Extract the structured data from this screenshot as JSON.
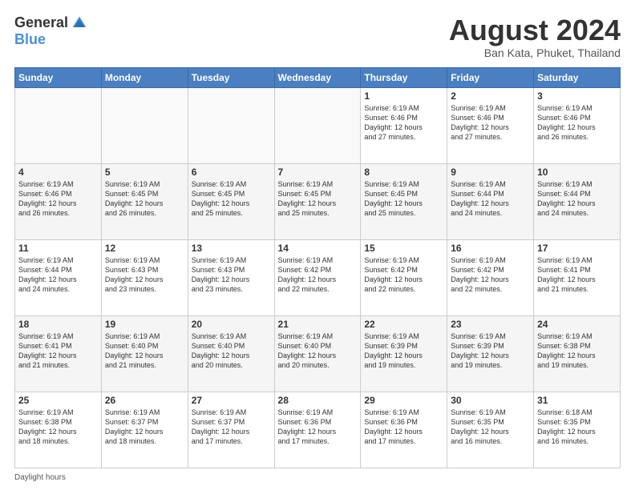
{
  "logo": {
    "general": "General",
    "blue": "Blue"
  },
  "header": {
    "month": "August 2024",
    "location": "Ban Kata, Phuket, Thailand"
  },
  "days_of_week": [
    "Sunday",
    "Monday",
    "Tuesday",
    "Wednesday",
    "Thursday",
    "Friday",
    "Saturday"
  ],
  "weeks": [
    [
      {
        "day": "",
        "detail": ""
      },
      {
        "day": "",
        "detail": ""
      },
      {
        "day": "",
        "detail": ""
      },
      {
        "day": "",
        "detail": ""
      },
      {
        "day": "1",
        "detail": "Sunrise: 6:19 AM\nSunset: 6:46 PM\nDaylight: 12 hours\nand 27 minutes."
      },
      {
        "day": "2",
        "detail": "Sunrise: 6:19 AM\nSunset: 6:46 PM\nDaylight: 12 hours\nand 27 minutes."
      },
      {
        "day": "3",
        "detail": "Sunrise: 6:19 AM\nSunset: 6:46 PM\nDaylight: 12 hours\nand 26 minutes."
      }
    ],
    [
      {
        "day": "4",
        "detail": "Sunrise: 6:19 AM\nSunset: 6:46 PM\nDaylight: 12 hours\nand 26 minutes."
      },
      {
        "day": "5",
        "detail": "Sunrise: 6:19 AM\nSunset: 6:45 PM\nDaylight: 12 hours\nand 26 minutes."
      },
      {
        "day": "6",
        "detail": "Sunrise: 6:19 AM\nSunset: 6:45 PM\nDaylight: 12 hours\nand 25 minutes."
      },
      {
        "day": "7",
        "detail": "Sunrise: 6:19 AM\nSunset: 6:45 PM\nDaylight: 12 hours\nand 25 minutes."
      },
      {
        "day": "8",
        "detail": "Sunrise: 6:19 AM\nSunset: 6:45 PM\nDaylight: 12 hours\nand 25 minutes."
      },
      {
        "day": "9",
        "detail": "Sunrise: 6:19 AM\nSunset: 6:44 PM\nDaylight: 12 hours\nand 24 minutes."
      },
      {
        "day": "10",
        "detail": "Sunrise: 6:19 AM\nSunset: 6:44 PM\nDaylight: 12 hours\nand 24 minutes."
      }
    ],
    [
      {
        "day": "11",
        "detail": "Sunrise: 6:19 AM\nSunset: 6:44 PM\nDaylight: 12 hours\nand 24 minutes."
      },
      {
        "day": "12",
        "detail": "Sunrise: 6:19 AM\nSunset: 6:43 PM\nDaylight: 12 hours\nand 23 minutes."
      },
      {
        "day": "13",
        "detail": "Sunrise: 6:19 AM\nSunset: 6:43 PM\nDaylight: 12 hours\nand 23 minutes."
      },
      {
        "day": "14",
        "detail": "Sunrise: 6:19 AM\nSunset: 6:42 PM\nDaylight: 12 hours\nand 22 minutes."
      },
      {
        "day": "15",
        "detail": "Sunrise: 6:19 AM\nSunset: 6:42 PM\nDaylight: 12 hours\nand 22 minutes."
      },
      {
        "day": "16",
        "detail": "Sunrise: 6:19 AM\nSunset: 6:42 PM\nDaylight: 12 hours\nand 22 minutes."
      },
      {
        "day": "17",
        "detail": "Sunrise: 6:19 AM\nSunset: 6:41 PM\nDaylight: 12 hours\nand 21 minutes."
      }
    ],
    [
      {
        "day": "18",
        "detail": "Sunrise: 6:19 AM\nSunset: 6:41 PM\nDaylight: 12 hours\nand 21 minutes."
      },
      {
        "day": "19",
        "detail": "Sunrise: 6:19 AM\nSunset: 6:40 PM\nDaylight: 12 hours\nand 21 minutes."
      },
      {
        "day": "20",
        "detail": "Sunrise: 6:19 AM\nSunset: 6:40 PM\nDaylight: 12 hours\nand 20 minutes."
      },
      {
        "day": "21",
        "detail": "Sunrise: 6:19 AM\nSunset: 6:40 PM\nDaylight: 12 hours\nand 20 minutes."
      },
      {
        "day": "22",
        "detail": "Sunrise: 6:19 AM\nSunset: 6:39 PM\nDaylight: 12 hours\nand 19 minutes."
      },
      {
        "day": "23",
        "detail": "Sunrise: 6:19 AM\nSunset: 6:39 PM\nDaylight: 12 hours\nand 19 minutes."
      },
      {
        "day": "24",
        "detail": "Sunrise: 6:19 AM\nSunset: 6:38 PM\nDaylight: 12 hours\nand 19 minutes."
      }
    ],
    [
      {
        "day": "25",
        "detail": "Sunrise: 6:19 AM\nSunset: 6:38 PM\nDaylight: 12 hours\nand 18 minutes."
      },
      {
        "day": "26",
        "detail": "Sunrise: 6:19 AM\nSunset: 6:37 PM\nDaylight: 12 hours\nand 18 minutes."
      },
      {
        "day": "27",
        "detail": "Sunrise: 6:19 AM\nSunset: 6:37 PM\nDaylight: 12 hours\nand 17 minutes."
      },
      {
        "day": "28",
        "detail": "Sunrise: 6:19 AM\nSunset: 6:36 PM\nDaylight: 12 hours\nand 17 minutes."
      },
      {
        "day": "29",
        "detail": "Sunrise: 6:19 AM\nSunset: 6:36 PM\nDaylight: 12 hours\nand 17 minutes."
      },
      {
        "day": "30",
        "detail": "Sunrise: 6:19 AM\nSunset: 6:35 PM\nDaylight: 12 hours\nand 16 minutes."
      },
      {
        "day": "31",
        "detail": "Sunrise: 6:18 AM\nSunset: 6:35 PM\nDaylight: 12 hours\nand 16 minutes."
      }
    ]
  ],
  "footer": {
    "text": "Daylight hours"
  }
}
